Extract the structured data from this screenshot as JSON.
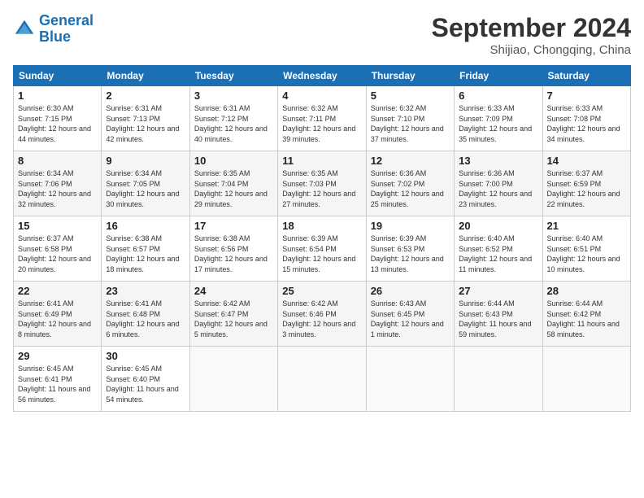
{
  "logo": {
    "text_general": "General",
    "text_blue": "Blue"
  },
  "header": {
    "month": "September 2024",
    "location": "Shijiao, Chongqing, China"
  },
  "weekdays": [
    "Sunday",
    "Monday",
    "Tuesday",
    "Wednesday",
    "Thursday",
    "Friday",
    "Saturday"
  ],
  "weeks": [
    [
      {
        "day": "1",
        "sunrise": "6:30 AM",
        "sunset": "7:15 PM",
        "daylight": "12 hours and 44 minutes."
      },
      {
        "day": "2",
        "sunrise": "6:31 AM",
        "sunset": "7:13 PM",
        "daylight": "12 hours and 42 minutes."
      },
      {
        "day": "3",
        "sunrise": "6:31 AM",
        "sunset": "7:12 PM",
        "daylight": "12 hours and 40 minutes."
      },
      {
        "day": "4",
        "sunrise": "6:32 AM",
        "sunset": "7:11 PM",
        "daylight": "12 hours and 39 minutes."
      },
      {
        "day": "5",
        "sunrise": "6:32 AM",
        "sunset": "7:10 PM",
        "daylight": "12 hours and 37 minutes."
      },
      {
        "day": "6",
        "sunrise": "6:33 AM",
        "sunset": "7:09 PM",
        "daylight": "12 hours and 35 minutes."
      },
      {
        "day": "7",
        "sunrise": "6:33 AM",
        "sunset": "7:08 PM",
        "daylight": "12 hours and 34 minutes."
      }
    ],
    [
      {
        "day": "8",
        "sunrise": "6:34 AM",
        "sunset": "7:06 PM",
        "daylight": "12 hours and 32 minutes."
      },
      {
        "day": "9",
        "sunrise": "6:34 AM",
        "sunset": "7:05 PM",
        "daylight": "12 hours and 30 minutes."
      },
      {
        "day": "10",
        "sunrise": "6:35 AM",
        "sunset": "7:04 PM",
        "daylight": "12 hours and 29 minutes."
      },
      {
        "day": "11",
        "sunrise": "6:35 AM",
        "sunset": "7:03 PM",
        "daylight": "12 hours and 27 minutes."
      },
      {
        "day": "12",
        "sunrise": "6:36 AM",
        "sunset": "7:02 PM",
        "daylight": "12 hours and 25 minutes."
      },
      {
        "day": "13",
        "sunrise": "6:36 AM",
        "sunset": "7:00 PM",
        "daylight": "12 hours and 23 minutes."
      },
      {
        "day": "14",
        "sunrise": "6:37 AM",
        "sunset": "6:59 PM",
        "daylight": "12 hours and 22 minutes."
      }
    ],
    [
      {
        "day": "15",
        "sunrise": "6:37 AM",
        "sunset": "6:58 PM",
        "daylight": "12 hours and 20 minutes."
      },
      {
        "day": "16",
        "sunrise": "6:38 AM",
        "sunset": "6:57 PM",
        "daylight": "12 hours and 18 minutes."
      },
      {
        "day": "17",
        "sunrise": "6:38 AM",
        "sunset": "6:56 PM",
        "daylight": "12 hours and 17 minutes."
      },
      {
        "day": "18",
        "sunrise": "6:39 AM",
        "sunset": "6:54 PM",
        "daylight": "12 hours and 15 minutes."
      },
      {
        "day": "19",
        "sunrise": "6:39 AM",
        "sunset": "6:53 PM",
        "daylight": "12 hours and 13 minutes."
      },
      {
        "day": "20",
        "sunrise": "6:40 AM",
        "sunset": "6:52 PM",
        "daylight": "12 hours and 11 minutes."
      },
      {
        "day": "21",
        "sunrise": "6:40 AM",
        "sunset": "6:51 PM",
        "daylight": "12 hours and 10 minutes."
      }
    ],
    [
      {
        "day": "22",
        "sunrise": "6:41 AM",
        "sunset": "6:49 PM",
        "daylight": "12 hours and 8 minutes."
      },
      {
        "day": "23",
        "sunrise": "6:41 AM",
        "sunset": "6:48 PM",
        "daylight": "12 hours and 6 minutes."
      },
      {
        "day": "24",
        "sunrise": "6:42 AM",
        "sunset": "6:47 PM",
        "daylight": "12 hours and 5 minutes."
      },
      {
        "day": "25",
        "sunrise": "6:42 AM",
        "sunset": "6:46 PM",
        "daylight": "12 hours and 3 minutes."
      },
      {
        "day": "26",
        "sunrise": "6:43 AM",
        "sunset": "6:45 PM",
        "daylight": "12 hours and 1 minute."
      },
      {
        "day": "27",
        "sunrise": "6:44 AM",
        "sunset": "6:43 PM",
        "daylight": "11 hours and 59 minutes."
      },
      {
        "day": "28",
        "sunrise": "6:44 AM",
        "sunset": "6:42 PM",
        "daylight": "11 hours and 58 minutes."
      }
    ],
    [
      {
        "day": "29",
        "sunrise": "6:45 AM",
        "sunset": "6:41 PM",
        "daylight": "11 hours and 56 minutes."
      },
      {
        "day": "30",
        "sunrise": "6:45 AM",
        "sunset": "6:40 PM",
        "daylight": "11 hours and 54 minutes."
      },
      null,
      null,
      null,
      null,
      null
    ]
  ]
}
